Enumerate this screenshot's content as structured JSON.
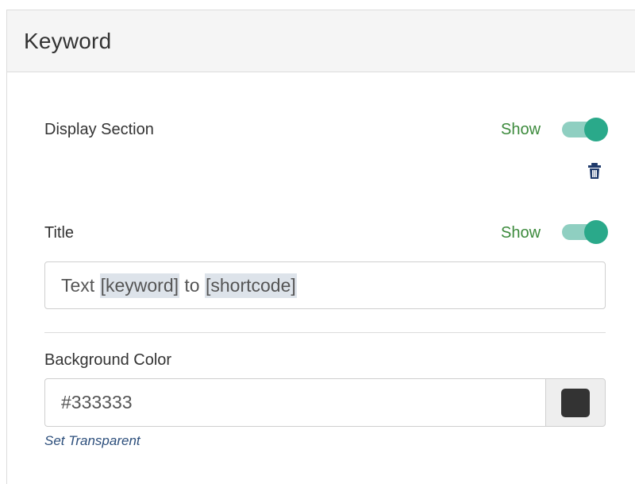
{
  "panel": {
    "title": "Keyword"
  },
  "display_section": {
    "label": "Display Section",
    "toggle_label": "Show",
    "toggle_on": true
  },
  "delete": {
    "icon": "trash-icon"
  },
  "title_row": {
    "label": "Title",
    "toggle_label": "Show",
    "toggle_on": true,
    "value_parts": [
      "Text ",
      "[keyword]",
      " to ",
      "[shortcode]"
    ]
  },
  "background_color": {
    "label": "Background Color",
    "value": "#333333",
    "swatch_color": "#333333",
    "set_transparent": "Set Transparent"
  },
  "colors": {
    "accent": "#2aa98a",
    "accent_track": "#8fcfc1",
    "show_text": "#3c8a3c",
    "link": "#2d4f7c"
  }
}
